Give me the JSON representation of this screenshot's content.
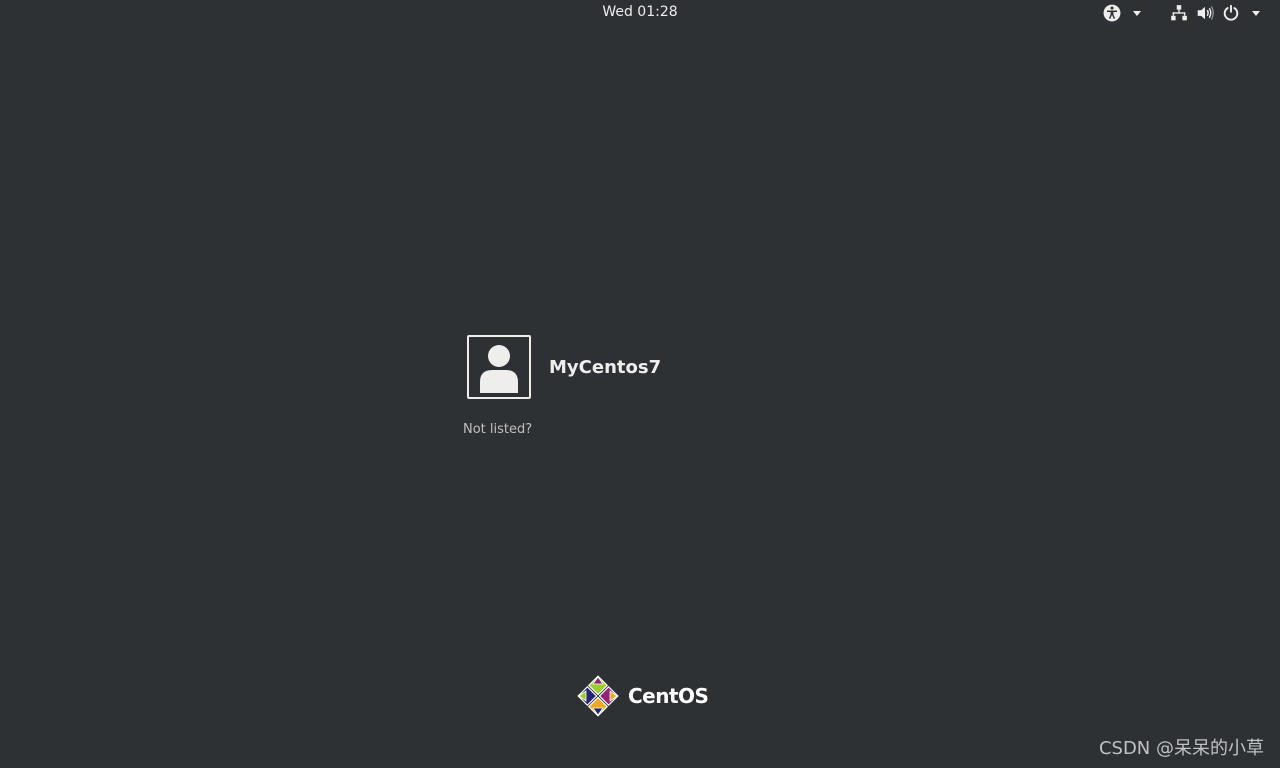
{
  "top_bar": {
    "clock": "Wed 01:28"
  },
  "icons": {
    "accessibility": "accessibility-icon",
    "network": "network-wired-icon",
    "volume": "volume-icon",
    "power": "power-icon"
  },
  "user_list": {
    "users": [
      {
        "name": "MyCentos7"
      }
    ],
    "not_listed_label": "Not listed?"
  },
  "branding": {
    "logo_text": "CentOS",
    "logo_colors": [
      "#9ccd2a",
      "#932279",
      "#efa724",
      "#262577"
    ]
  },
  "watermark": "CSDN @呆呆的小草",
  "colors": {
    "background": "#2e3134",
    "foreground": "#eeeeec"
  }
}
